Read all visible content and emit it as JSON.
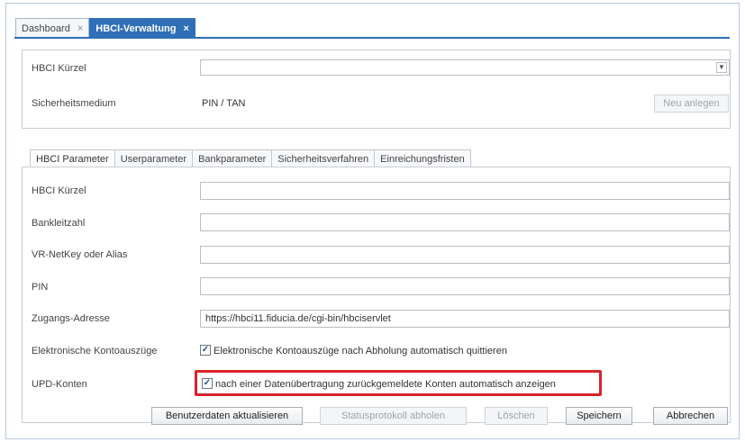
{
  "tabs": [
    {
      "label": "Dashboard",
      "close": "×"
    },
    {
      "label": "HBCI-Verwaltung",
      "close": "×"
    }
  ],
  "header": {
    "kuerzel_label": "HBCI Kürzel",
    "kuerzel_value": "",
    "dropdown_icon": "chevron-down-icon",
    "medium_label": "Sicherheitsmedium",
    "medium_value": "PIN / TAN",
    "new_button": "Neu anlegen"
  },
  "param_tabs": [
    "HBCI Parameter",
    "Userparameter",
    "Bankparameter",
    "Sicherheitsverfahren",
    "Einreichungsfristen"
  ],
  "form": {
    "fields": [
      {
        "label": "HBCI Kürzel",
        "value": ""
      },
      {
        "label": "Bankleitzahl",
        "value": ""
      },
      {
        "label": "VR-NetKey oder Alias",
        "value": ""
      },
      {
        "label": "PIN",
        "value": ""
      },
      {
        "label": "Zugangs-Adresse",
        "value": "https://hbci11.fiducia.de/cgi-bin/hbciservlet"
      }
    ],
    "kontoauszuege_label": "Elektronische Kontoauszüge",
    "kontoauszuege_checkbox": "Elektronische Kontoauszüge nach Abholung automatisch quittieren",
    "kontoauszuege_checked": true,
    "upd_label": "UPD-Konten",
    "upd_checkbox": "nach einer Datenübertragung zurückgemeldete Konten automatisch anzeigen",
    "upd_checked": true,
    "check_mark": "✓"
  },
  "buttons": {
    "update": "Benutzerdaten aktualisieren",
    "status": "Statusprotokoll abholen",
    "delete": "Löschen",
    "save": "Speichern",
    "cancel": "Abbrechen"
  },
  "colors": {
    "accent": "#2f6fb8",
    "highlight": "#d8232a"
  }
}
